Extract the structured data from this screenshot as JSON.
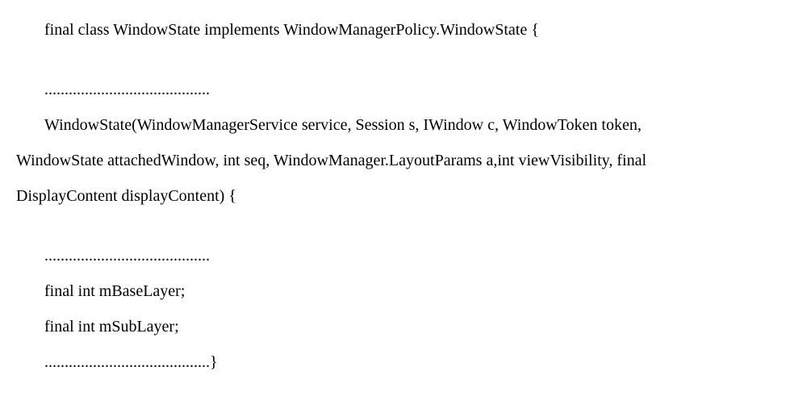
{
  "code": {
    "line1": "final class WindowState implements WindowManagerPolicy.WindowState {",
    "ellipsis1": ".........................................",
    "line2a": "WindowState(WindowManagerService service, Session s, IWindow c, WindowToken token,",
    "line2b": "WindowState attachedWindow, int seq, WindowManager.LayoutParams a,int viewVisibility, final",
    "line2c": "DisplayContent displayContent) {",
    "ellipsis2": ".........................................",
    "line3": "final int mBaseLayer;",
    "line4": "final int mSubLayer;",
    "ellipsis3": ".........................................}"
  }
}
